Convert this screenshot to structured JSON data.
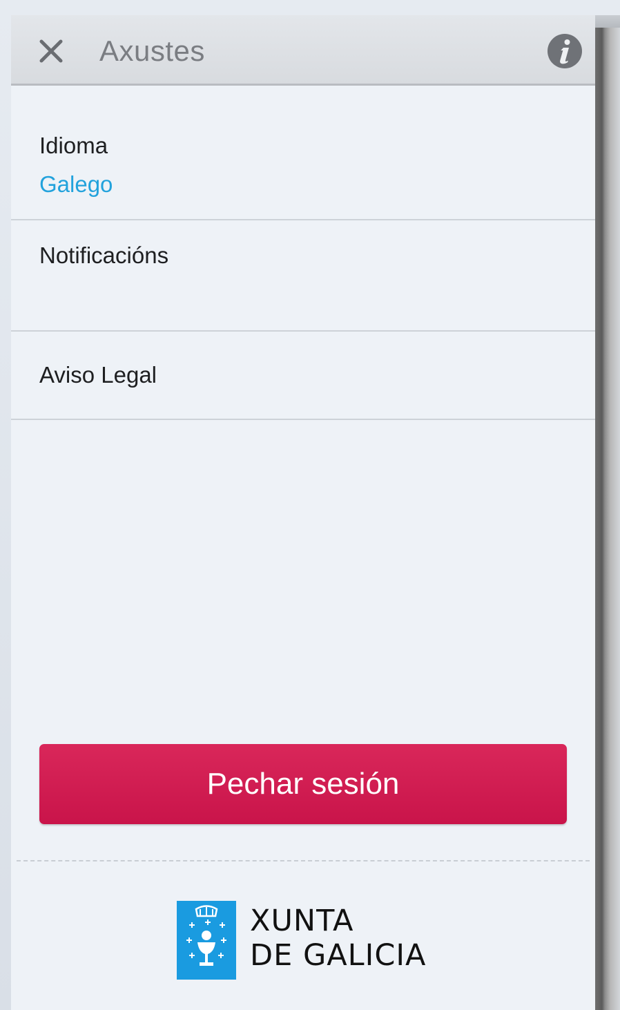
{
  "header": {
    "title": "Axustes",
    "close_icon": "close-icon",
    "info_icon": "info-icon"
  },
  "settings": {
    "language": {
      "label": "Idioma",
      "value": "Galego"
    },
    "notifications": {
      "label": "Notificacións"
    },
    "legal": {
      "label": "Aviso Legal"
    }
  },
  "logout": {
    "label": "Pechar sesión"
  },
  "footer": {
    "logo_line1": "XUNTA",
    "logo_line2": "DE GALICIA"
  },
  "colors": {
    "accent_blue": "#22a2dc",
    "logout_red": "#cc1a4f",
    "emblem_blue": "#1a9be0"
  }
}
